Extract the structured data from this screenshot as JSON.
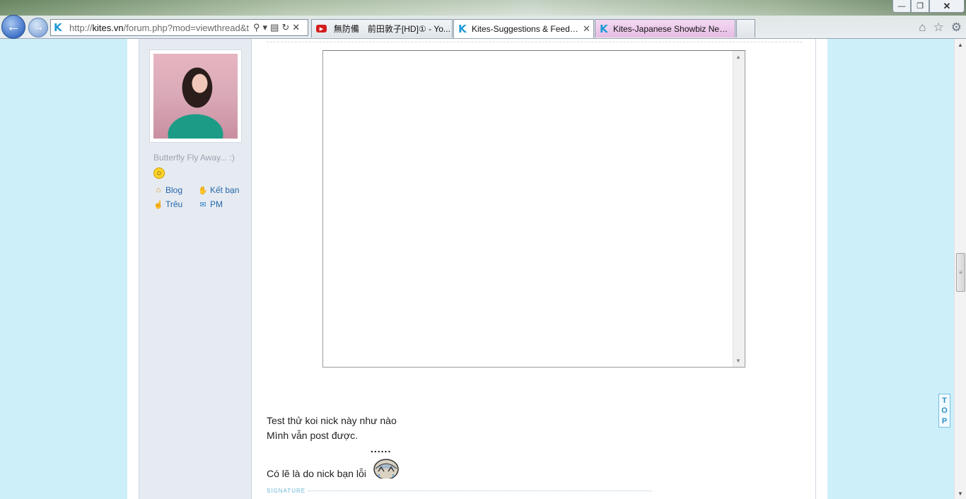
{
  "browser": {
    "address": {
      "url_prefix": "http://",
      "url_domain": "kites.vn",
      "url_rest": "/forum.php?mod=viewthread&tid"
    },
    "tabs": [
      {
        "label": "無防備　前田敦子[HD]① - Yo..."
      },
      {
        "label": "Kites-Suggestions & Feedb..."
      },
      {
        "label": "Kites-Japanese Showbiz News-..."
      }
    ],
    "window_buttons": {
      "minimize": "—",
      "maximize": "❐",
      "close": "✕"
    }
  },
  "sidebar": {
    "signature_line": "Butterfly Fly Away... :)",
    "links": [
      {
        "label": "Blog",
        "icon": "home-icon"
      },
      {
        "label": "Kết bạn",
        "icon": "handshake-icon"
      },
      {
        "label": "Trêu",
        "icon": "poke-icon"
      },
      {
        "label": "PM",
        "icon": "mail-icon"
      }
    ]
  },
  "post": {
    "line1": "Test thử koi nick này như nào",
    "line2": "Mình vẫn post được.",
    "dots": "......",
    "line3": "Có lẽ là do nick bạn lỗi",
    "signature_label": "SIGNATURE"
  },
  "top_button": {
    "letters": [
      "T",
      "O",
      "P"
    ]
  },
  "colors": {
    "page_bg": "#cdeffa",
    "link": "#2466a8",
    "sidebar_bg": "#e6ebf2"
  }
}
